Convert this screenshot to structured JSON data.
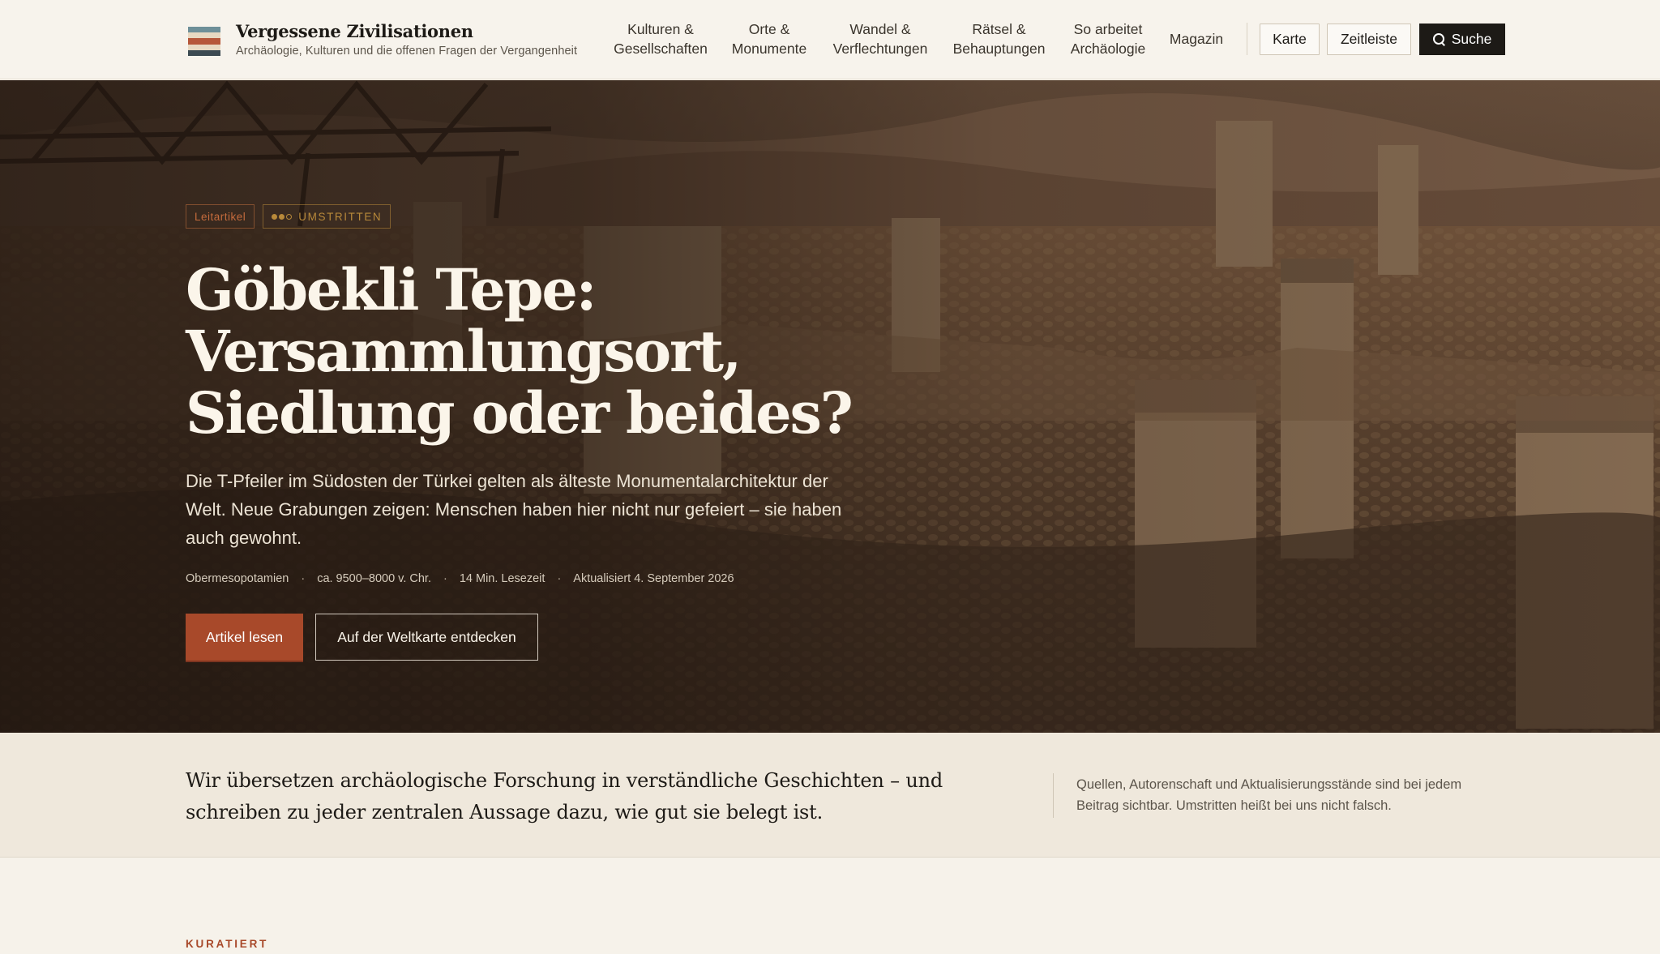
{
  "site": {
    "name": "Vergessene Zivilisationen",
    "tagline": "Archäologie, Kulturen und die offenen Fragen der Vergangenheit"
  },
  "nav": {
    "items": [
      {
        "label": "Kulturen &\nGesellschaften"
      },
      {
        "label": "Orte &\nMonumente"
      },
      {
        "label": "Wandel &\nVerflechtungen"
      },
      {
        "label": "Rätsel &\nBehauptungen"
      },
      {
        "label": "So arbeitet\nArchäologie"
      },
      {
        "label": "Magazin"
      }
    ],
    "map_label": "Karte",
    "timeline_label": "Zeitleiste",
    "search_label": "Suche"
  },
  "hero": {
    "badge_feature": "Leitartikel",
    "badge_disputed": "UMSTRITTEN",
    "title_lines": [
      "Göbekli Tepe:",
      "Versammlungsort,",
      "Siedlung oder beides?"
    ],
    "lede": "Die T-Pfeiler im Südosten der Türkei gelten als älteste Monumentalarchitektur der Welt. Neue Grabungen zeigen: Menschen haben hier nicht nur gefeiert – sie haben auch gewohnt.",
    "meta": {
      "region": "Obermesopotamien",
      "period": "ca. 9500–8000 v. Chr.",
      "reading_time": "14 Min. Lesezeit",
      "updated": "Aktualisiert 4. September 2026",
      "separator": "·"
    },
    "cta_primary": "Artikel lesen",
    "cta_secondary": "Auf der Weltkarte entdecken"
  },
  "mission": {
    "statement": "Wir übersetzen archäologische Forschung in verständliche Geschichten – und schreiben zu jeder zentralen Aussage dazu, wie gut sie belegt ist.",
    "note": "Quellen, Autorenschaft und Aktualisierungsstände sind bei jedem Beitrag sichtbar. Umstritten heißt bei uns nicht falsch."
  },
  "curated": {
    "label": "KURATIERT"
  },
  "colors": {
    "accent": "#a8492a",
    "disputed": "#b8893a",
    "ink": "#1d1a16",
    "paper": "#f6f2ea"
  }
}
